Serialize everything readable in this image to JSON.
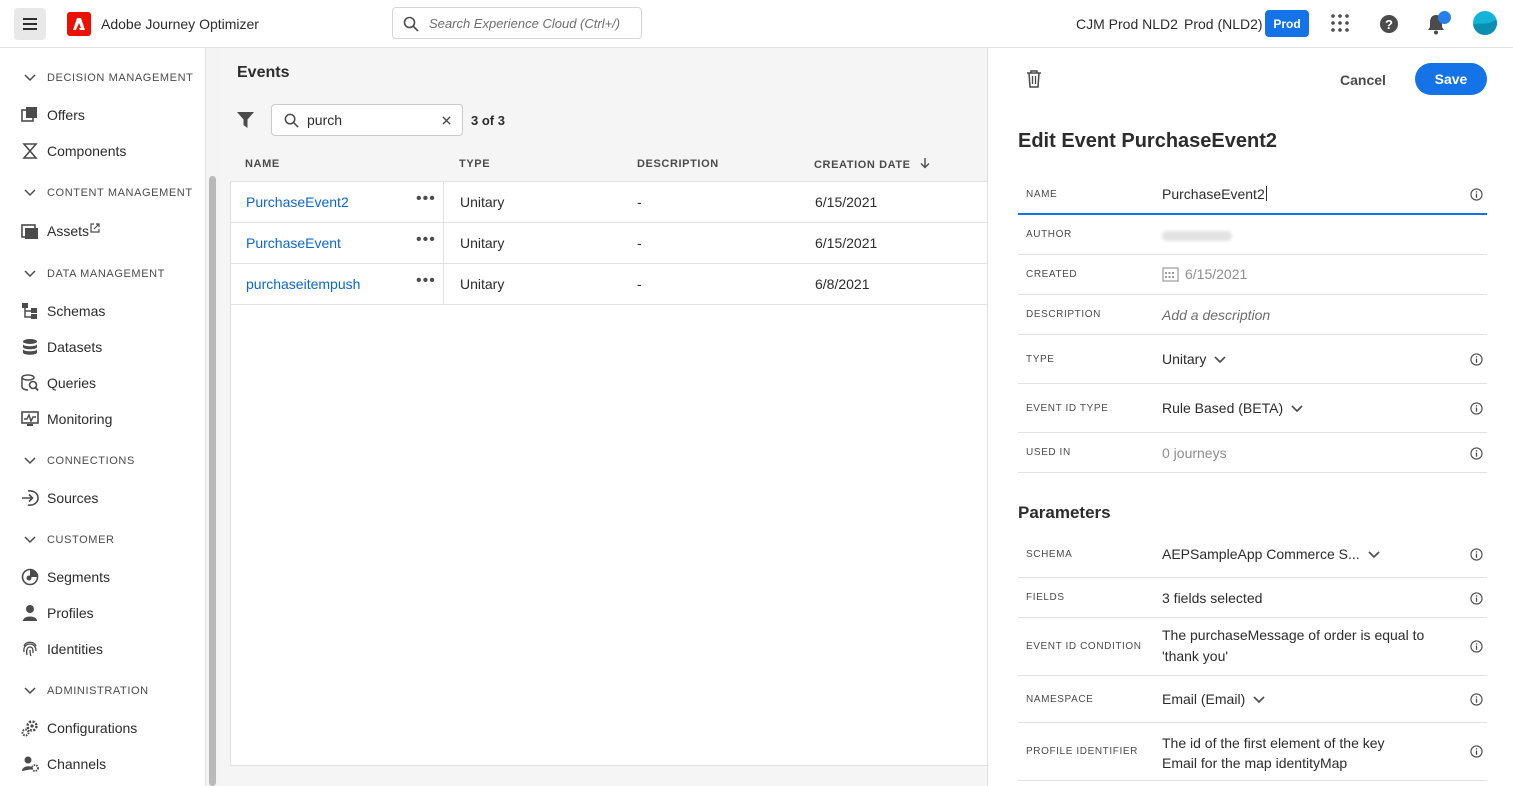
{
  "header": {
    "app_title": "Adobe Journey Optimizer",
    "search_placeholder": "Search Experience Cloud (Ctrl+/)",
    "org": "CJM Prod NLD2",
    "sandbox": "Prod (NLD2)",
    "env_badge": "Prod"
  },
  "sidebar": {
    "sections": [
      {
        "title": "DECISION MANAGEMENT",
        "items": [
          {
            "label": "Offers",
            "icon": "offers-icon"
          },
          {
            "label": "Components",
            "icon": "components-icon"
          }
        ]
      },
      {
        "title": "CONTENT MANAGEMENT",
        "items": [
          {
            "label": "Assets",
            "icon": "assets-icon"
          }
        ]
      },
      {
        "title": "DATA MANAGEMENT",
        "items": [
          {
            "label": "Schemas",
            "icon": "schemas-icon"
          },
          {
            "label": "Datasets",
            "icon": "datasets-icon"
          },
          {
            "label": "Queries",
            "icon": "queries-icon"
          },
          {
            "label": "Monitoring",
            "icon": "monitoring-icon"
          }
        ]
      },
      {
        "title": "CONNECTIONS",
        "items": [
          {
            "label": "Sources",
            "icon": "sources-icon"
          }
        ]
      },
      {
        "title": "CUSTOMER",
        "items": [
          {
            "label": "Segments",
            "icon": "segments-icon"
          },
          {
            "label": "Profiles",
            "icon": "profiles-icon"
          },
          {
            "label": "Identities",
            "icon": "identities-icon"
          }
        ]
      },
      {
        "title": "ADMINISTRATION",
        "items": [
          {
            "label": "Configurations",
            "icon": "configurations-icon"
          },
          {
            "label": "Channels",
            "icon": "channels-icon"
          }
        ]
      }
    ]
  },
  "main": {
    "title": "Events",
    "filter_value": "purch",
    "count_bold": "3 of 3",
    "columns": [
      "NAME",
      "TYPE",
      "DESCRIPTION",
      "CREATION DATE"
    ],
    "rows": [
      {
        "name": "PurchaseEvent2",
        "type": "Unitary",
        "description": "-",
        "date": "6/15/2021"
      },
      {
        "name": "PurchaseEvent",
        "type": "Unitary",
        "description": "-",
        "date": "6/15/2021"
      },
      {
        "name": "purchaseitempush",
        "type": "Unitary",
        "description": "-",
        "date": "6/8/2021"
      }
    ]
  },
  "panel": {
    "cancel_label": "Cancel",
    "save_label": "Save",
    "title": "Edit Event PurchaseEvent2",
    "fields": {
      "name": {
        "label": "NAME",
        "value": "PurchaseEvent2"
      },
      "author": {
        "label": "AUTHOR"
      },
      "created": {
        "label": "CREATED",
        "value": "6/15/2021"
      },
      "description": {
        "label": "DESCRIPTION",
        "placeholder": "Add a description"
      },
      "type": {
        "label": "TYPE",
        "value": "Unitary"
      },
      "event_id_type": {
        "label": "EVENT ID TYPE",
        "value": "Rule Based (BETA)"
      },
      "used_in": {
        "label": "USED IN",
        "value": "0 journeys"
      }
    },
    "params_title": "Parameters",
    "params": {
      "schema": {
        "label": "SCHEMA",
        "value": "AEPSampleApp Commerce S..."
      },
      "fields": {
        "label": "FIELDS",
        "value": "3 fields selected"
      },
      "event_id_condition": {
        "label": "EVENT ID CONDITION",
        "line1": "The purchaseMessage of order is equal to",
        "line2": "'thank you'"
      },
      "namespace": {
        "label": "NAMESPACE",
        "value": "Email (Email)"
      },
      "profile_identifier": {
        "label": "PROFILE IDENTIFIER",
        "line1": "The id of the first element of the key",
        "line2": "Email for the map identityMap"
      }
    }
  }
}
